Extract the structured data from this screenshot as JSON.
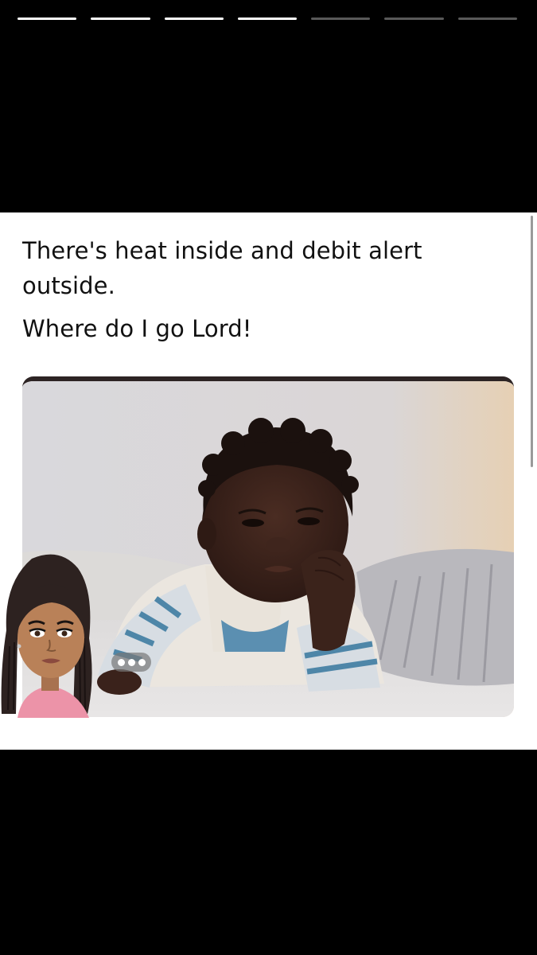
{
  "story": {
    "total_segments": 7,
    "completed_segments": 4,
    "bar_color": "#ffffff"
  },
  "post": {
    "line_1": "There's heat inside and debit alert outside.",
    "line_2": "Where do I go Lord!"
  },
  "image": {
    "subject": "baby-resting-chin-on-hand",
    "icon": "photo-icon"
  },
  "overlay": {
    "avatar_icon": "bitmoji-avatar-icon",
    "typing_icon": "typing-dots-icon"
  }
}
